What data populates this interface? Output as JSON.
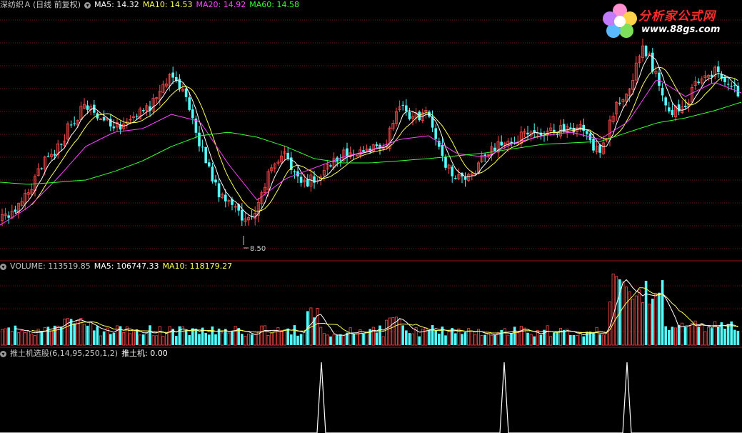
{
  "colors": {
    "bg": "#000000",
    "grid": "#7a1010",
    "up": "#ff4a4a",
    "down": "#54ffff",
    "ma5": "#ffffff",
    "ma10": "#ffff55",
    "ma20": "#ff44ff",
    "ma60": "#33ff33",
    "indicator": "#ffffff",
    "label_gray": "#c8c8c8"
  },
  "price_panel": {
    "stock": "深纺织Ａ",
    "mode": "(日线 前复权)",
    "ma5": "MA5: 14.32",
    "ma10": "MA10: 14.53",
    "ma20": "MA20: 14.92",
    "ma60": "MA60: 14.58",
    "low_label": "8.50"
  },
  "volume_panel": {
    "volume": "VOLUME: 113519.85",
    "ma5": "MA5: 106747.33",
    "ma10": "MA10: 118179.27"
  },
  "indicator_panel": {
    "name": "推土机选股(6,14,95,250,1,2)",
    "value": "推土机: 0.00"
  },
  "watermark": {
    "name": "分析家公式网",
    "url": "www.88gs.com"
  },
  "chart_data": [
    {
      "type": "candlestick",
      "title": "深纺织Ａ (日线 前复权)",
      "series": [
        {
          "name": "MA5",
          "value": 14.32
        },
        {
          "name": "MA10",
          "value": 14.53
        },
        {
          "name": "MA20",
          "value": 14.92
        },
        {
          "name": "MA60",
          "value": 14.58
        }
      ],
      "annotations": [
        {
          "text": "8.50",
          "meaning": "period low"
        }
      ],
      "price_path": {
        "x": [
          0,
          20,
          40,
          60,
          80,
          100,
          120,
          140,
          160,
          180,
          200,
          220,
          240,
          260,
          280,
          300,
          320,
          340,
          360,
          380,
          400,
          420,
          440,
          460,
          480,
          500,
          520,
          540,
          560,
          580,
          600,
          620,
          640,
          660,
          680,
          700,
          720,
          740,
          760,
          780,
          800,
          820,
          840,
          860,
          880,
          900,
          920,
          940,
          960,
          980,
          1000,
          1020,
          1038
        ],
        "y": [
          310,
          300,
          270,
          230,
          210,
          170,
          150,
          165,
          180,
          175,
          155,
          140,
          100,
          140,
          200,
          260,
          285,
          305,
          290,
          230,
          215,
          260,
          250,
          235,
          215,
          210,
          205,
          200,
          150,
          165,
          160,
          225,
          250,
          245,
          210,
          205,
          195,
          180,
          185,
          185,
          178,
          185,
          220,
          150,
          130,
          60,
          110,
          160,
          145,
          110,
          100,
          120,
          130
        ]
      },
      "ma60_path": {
        "x": [
          0,
          40,
          80,
          120,
          160,
          200,
          240,
          280,
          320,
          360,
          400,
          440,
          480,
          520,
          560,
          600,
          640,
          680,
          720,
          760,
          800,
          840,
          880,
          920,
          960,
          1000,
          1038
        ],
        "y": [
          255,
          258,
          255,
          252,
          240,
          225,
          205,
          190,
          185,
          192,
          205,
          222,
          228,
          228,
          225,
          222,
          218,
          214,
          208,
          202,
          200,
          198,
          185,
          172,
          165,
          155,
          143
        ]
      },
      "ma20_path": {
        "x": [
          0,
          40,
          80,
          120,
          160,
          200,
          240,
          280,
          320,
          360,
          400,
          440,
          480,
          520,
          560,
          600,
          640,
          680,
          720,
          760,
          800,
          840,
          880,
          920,
          960,
          1000,
          1038
        ],
        "y": [
          315,
          290,
          250,
          205,
          185,
          180,
          160,
          170,
          230,
          280,
          250,
          235,
          220,
          210,
          195,
          190,
          215,
          220,
          200,
          190,
          185,
          195,
          170,
          110,
          135,
          115,
          130
        ]
      }
    },
    {
      "type": "bar",
      "title": "VOLUME",
      "series": [
        {
          "name": "VOLUME",
          "value": 113519.85
        },
        {
          "name": "MA5",
          "value": 106747.33
        },
        {
          "name": "MA10",
          "value": 118179.27
        }
      ]
    },
    {
      "type": "line",
      "title": "推土机选股(6,14,95,250,1,2)",
      "series": [
        {
          "name": "推土机",
          "value": 0.0
        }
      ],
      "spike_x": [
        450,
        706,
        878
      ]
    }
  ]
}
